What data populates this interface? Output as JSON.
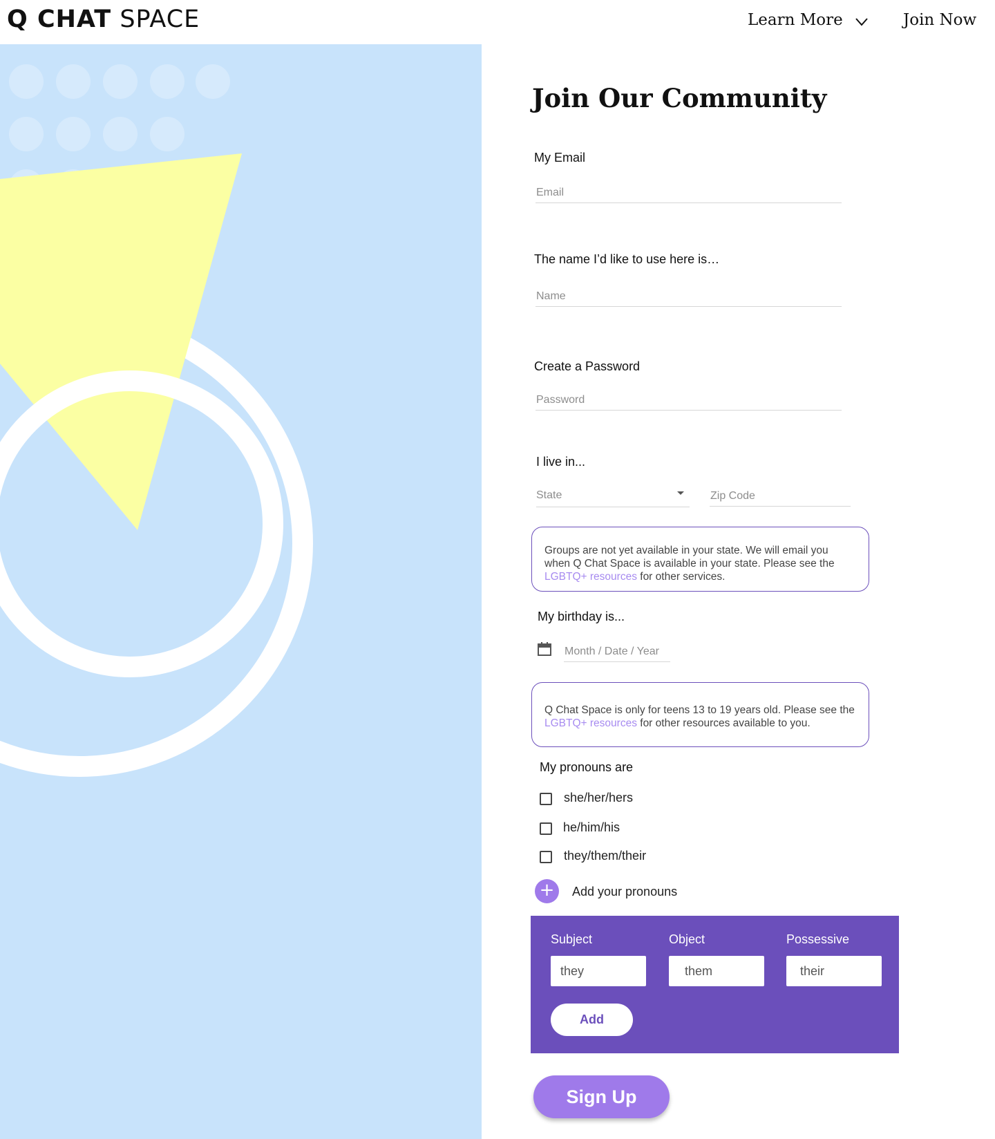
{
  "header": {
    "logo_bold": "Q CHAT",
    "logo_light": "SPACE",
    "nav_learn_more": "Learn More",
    "nav_join_now": "Join Now"
  },
  "form": {
    "title": "Join Our Community",
    "email_label": "My Email",
    "email_placeholder": "Email",
    "name_label": "The name I’d like to use here is…",
    "name_placeholder": "Name",
    "password_label": "Create a Password",
    "password_placeholder": "Password",
    "location_label": "I live in...",
    "state_placeholder": "State",
    "zip_placeholder": "Zip Code",
    "state_notice": {
      "text_before": "Groups are not yet available in your state. We will email you when Q Chat Space is available in your state. Please see the ",
      "link": "LGBTQ+ resources",
      "text_after": " for other services."
    },
    "birthday_label": "My birthday is...",
    "birthday_placeholder": "Month / Date / Year",
    "age_notice": {
      "text_before": "Q Chat Space is only for teens 13 to 19 years old. Please see the ",
      "link": "LGBTQ+ resources",
      "text_after": " for other resources available to you."
    },
    "pronouns_label": "My pronouns are",
    "pronoun_options": [
      "she/her/hers",
      "he/him/his",
      "they/them/their"
    ],
    "add_pronouns_label": "Add your pronouns",
    "pronoun_builder": {
      "subject_label": "Subject",
      "object_label": "Object",
      "possessive_label": "Possessive",
      "subject_value": "they",
      "object_value": "them",
      "possessive_value": "their",
      "add_label": "Add"
    },
    "signup_label": "Sign Up"
  },
  "colors": {
    "accent_purple": "#6b4fbb",
    "button_purple": "#9f7aea",
    "link_purple": "#a78bf0",
    "art_background": "#c8e3fb",
    "art_triangle": "#fbffa3"
  },
  "icons": {
    "nav_dropdown": "chevron-down-icon",
    "birthday": "calendar-icon",
    "add_pronouns": "plus-icon"
  }
}
